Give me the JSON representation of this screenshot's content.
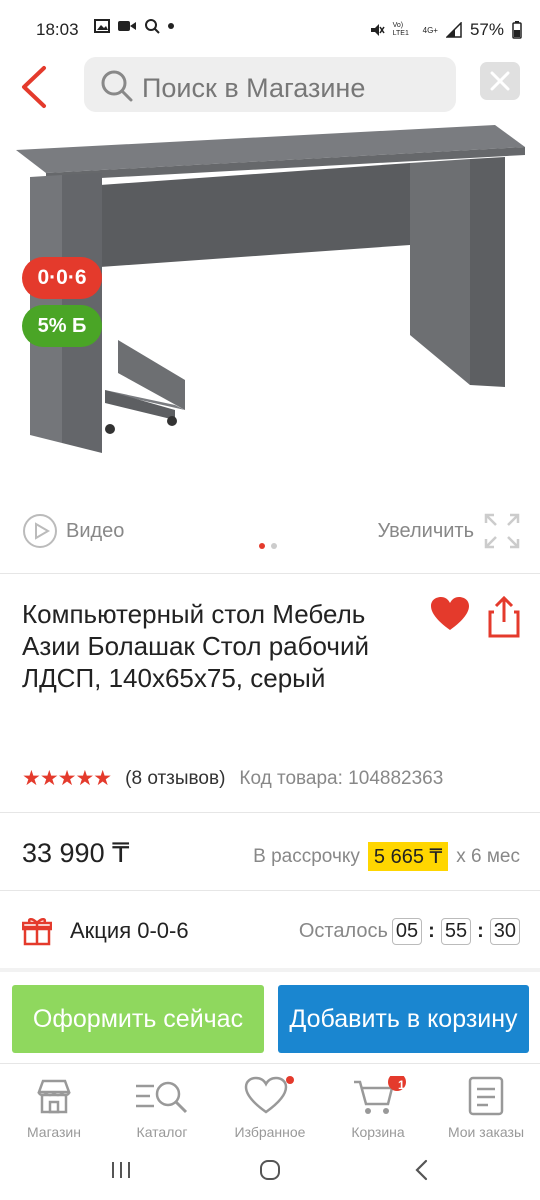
{
  "status_bar": {
    "time": "18:03",
    "battery": "57%",
    "network": "4G+",
    "volte": "Vo) LTE1"
  },
  "header": {
    "search_placeholder": "Поиск в Магазине"
  },
  "badges": {
    "installment": "0·0·6",
    "cashback": "5% Б"
  },
  "media": {
    "video_label": "Видео",
    "zoom_label": "Увеличить",
    "slide_count": 2,
    "active_slide": 1
  },
  "product": {
    "title": "Компьютерный стол Мебель Азии Болашак Стол рабочий ЛДСП, 140x65x75, серый",
    "stars": 5,
    "reviews": "(8 отзывов)",
    "code": "Код товара: 104882363",
    "price": "33 990 ₸",
    "installment_prefix": "В рассрочку",
    "installment_amount": "5 665 ₸",
    "installment_suffix": "x 6 мес"
  },
  "promo": {
    "label": "Акция 0-0-6",
    "remaining_label": "Осталось",
    "hours": "05",
    "minutes": "55",
    "seconds": "30"
  },
  "actions": {
    "buy_now": "Оформить сейчас",
    "add_to_cart": "Добавить в корзину"
  },
  "bottom_nav": [
    {
      "label": "Магазин"
    },
    {
      "label": "Каталог"
    },
    {
      "label": "Избранное"
    },
    {
      "label": "Корзина",
      "badge": "1"
    },
    {
      "label": "Мои заказы"
    }
  ],
  "colors": {
    "accent": "#e43a2c",
    "green": "#4aa526",
    "blue": "#1a86d0",
    "light_green": "#8fd85e",
    "yellow": "#ffd600"
  }
}
